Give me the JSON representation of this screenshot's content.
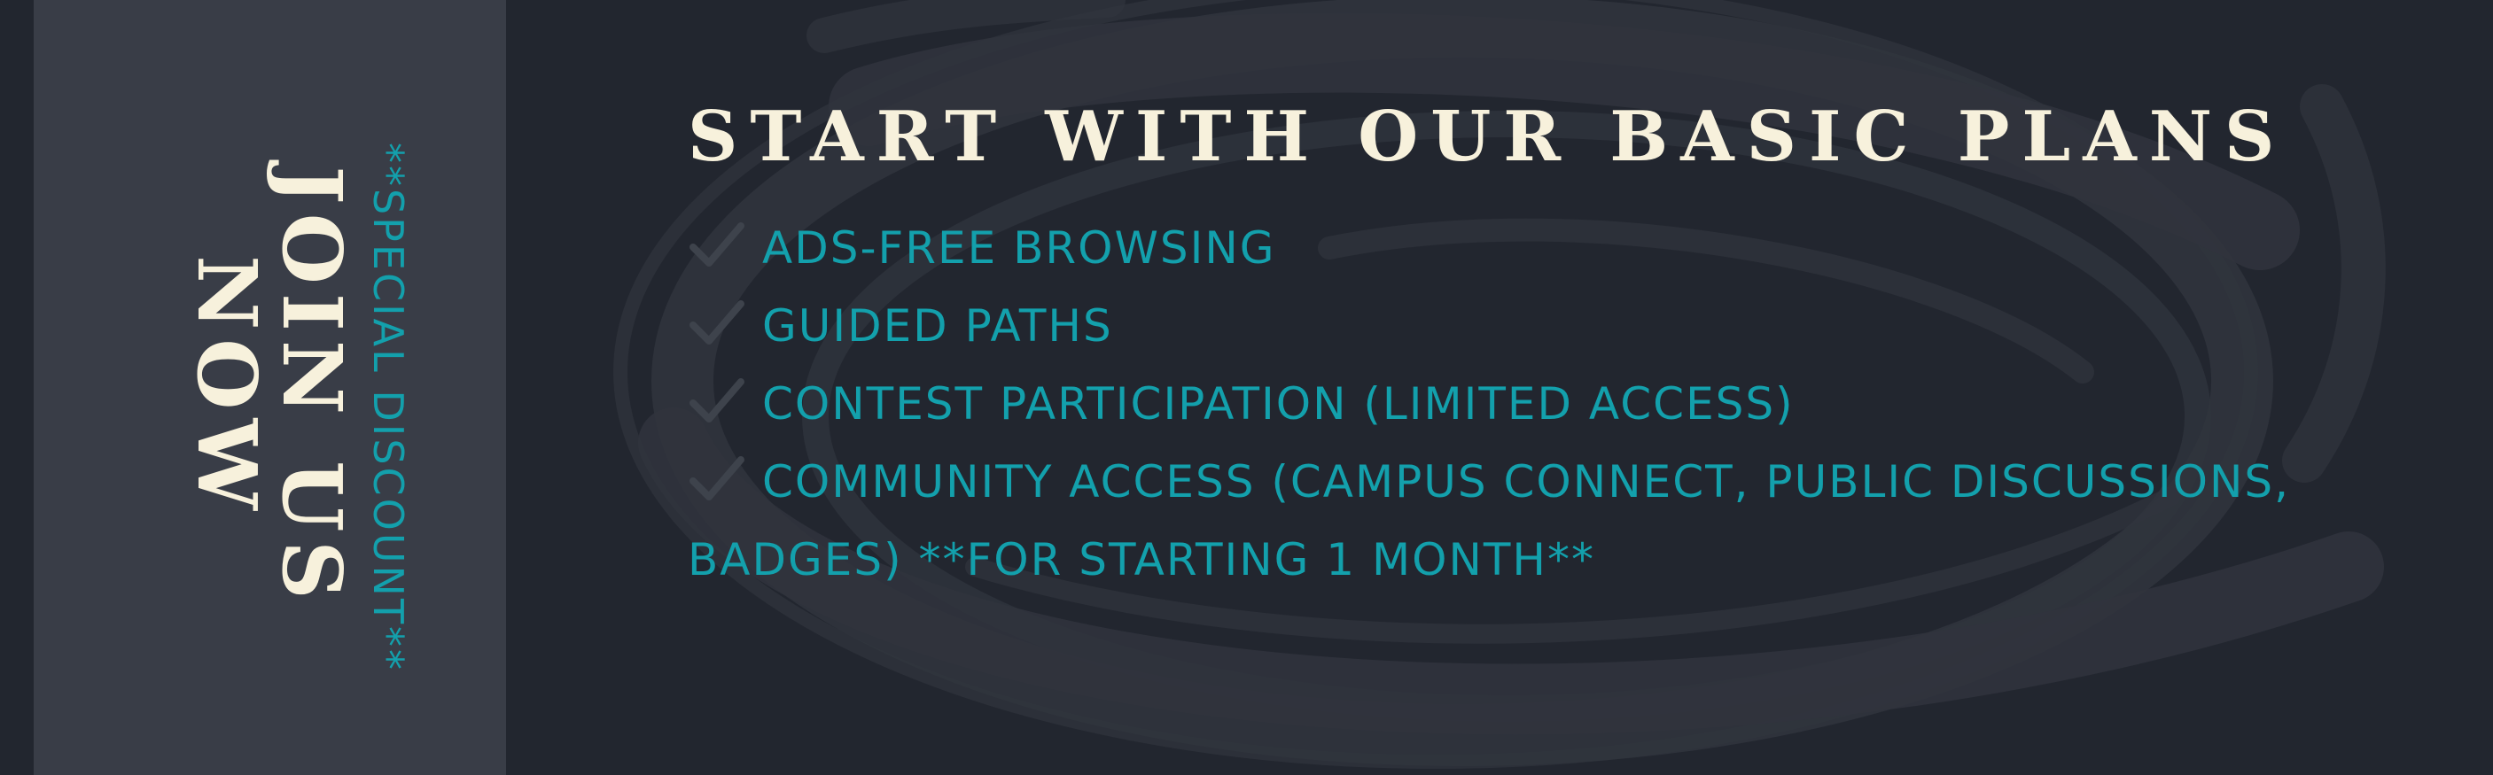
{
  "side_panel": {
    "title_lines": [
      "JOIN US",
      "NOW"
    ],
    "note": "**SPECIAL DISCOUNT**"
  },
  "main": {
    "headline": "START WITH OUR BASIC PLANS",
    "features": [
      {
        "icon": "check-icon",
        "text": "ADS-FREE BROWSING"
      },
      {
        "icon": "check-icon",
        "text": "GUIDED PATHS"
      },
      {
        "icon": "check-icon",
        "text": "CONTEST PARTICIPATION (LIMITED ACCESS)"
      },
      {
        "icon": "check-icon",
        "text": "COMMUNITY ACCESS (CAMPUS CONNECT, PUBLIC DISCUSSIONS, BADGES) **FOR STARTING 1 MONTH**"
      }
    ]
  },
  "colors": {
    "background": "#22262f",
    "panel": "#393d47",
    "title": "#f7f1dc",
    "accent": "#13a0ac",
    "brush": "#2f333c"
  }
}
